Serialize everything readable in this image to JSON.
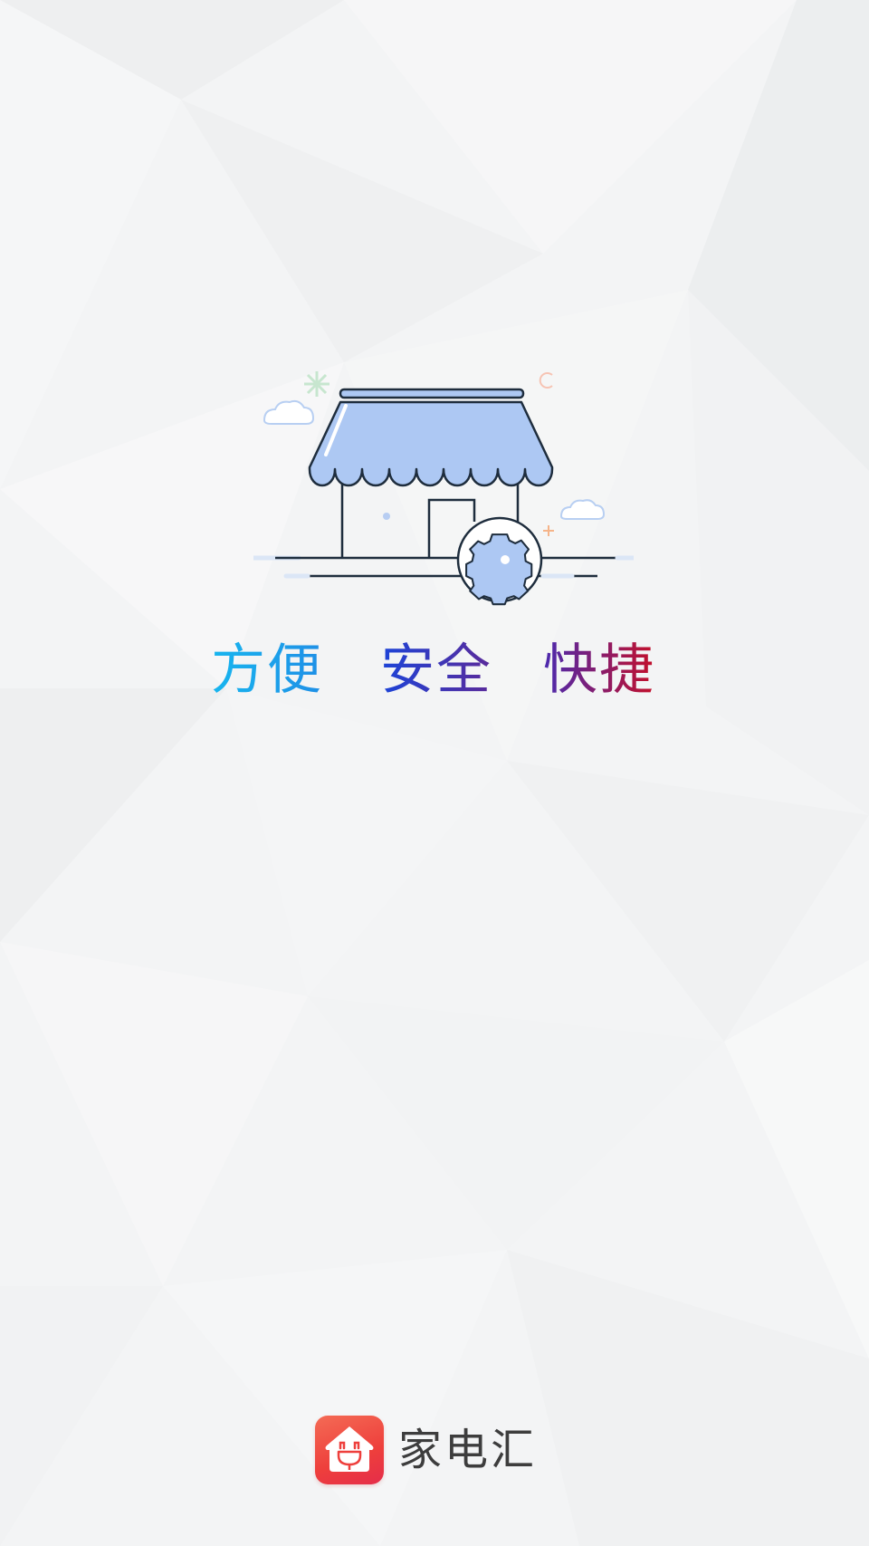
{
  "splash": {
    "slogan": [
      "方便",
      "安全",
      "快捷"
    ],
    "brand_name": "家电汇"
  },
  "colors": {
    "background": "#f3f4f5",
    "awning_fill": "#adc8f3",
    "outline": "#1e2d3d",
    "slogan_start": "#18b6ef",
    "slogan_end": "#c4102a",
    "logo_red": "#ee3f3c",
    "brand_text": "#3d3d3d"
  },
  "icons": [
    "store-illustration",
    "gear-icon",
    "cloud-icon",
    "sparkle-icon",
    "app-logo-house-icon"
  ]
}
